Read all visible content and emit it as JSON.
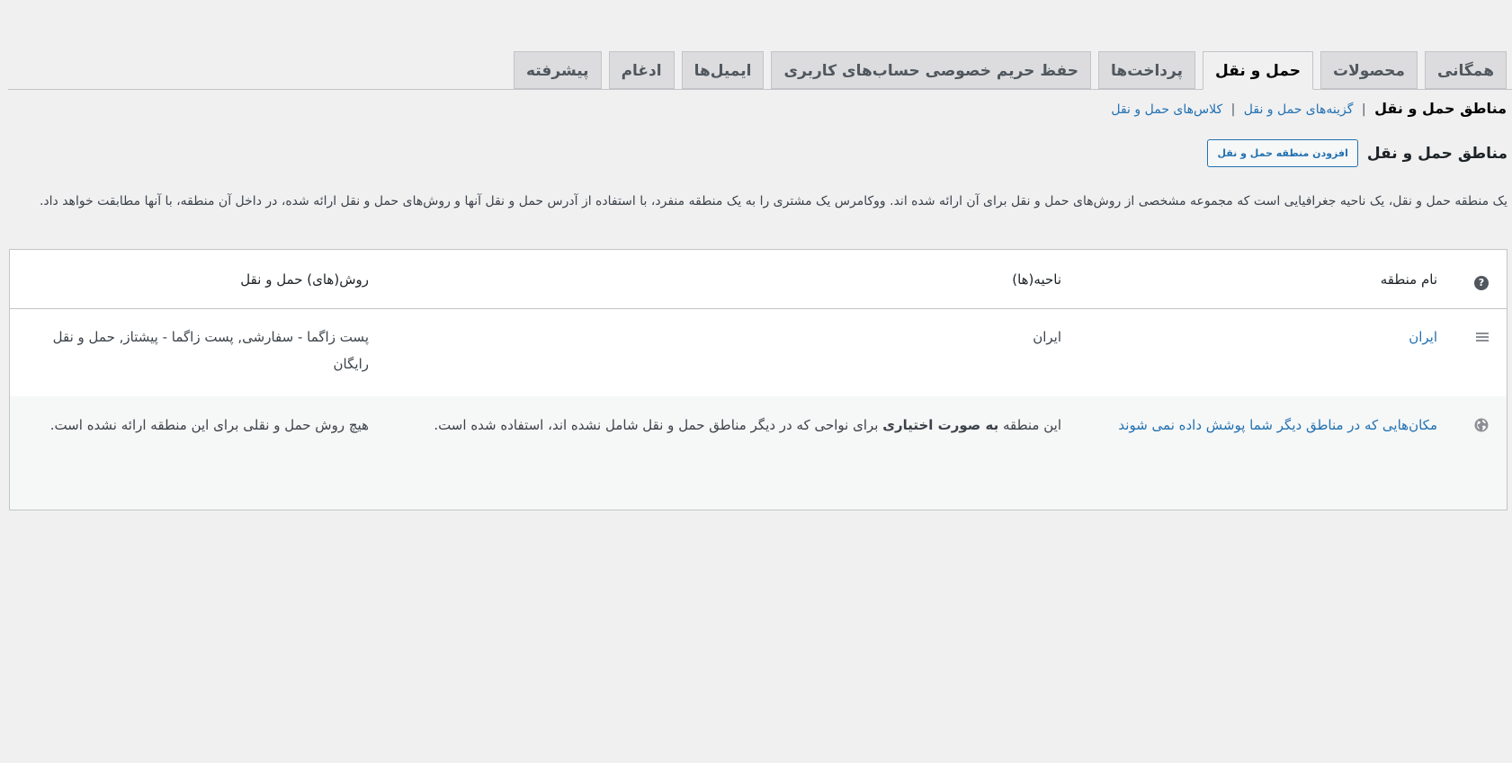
{
  "tabs": [
    {
      "label": "همگانی",
      "active": false
    },
    {
      "label": "محصولات",
      "active": false
    },
    {
      "label": "حمل و نقل",
      "active": true
    },
    {
      "label": "پرداخت‌ها",
      "active": false
    },
    {
      "label": "حفظ حریم خصوصی حساب‌های کاربری",
      "active": false
    },
    {
      "label": "ایمیل‌ها",
      "active": false
    },
    {
      "label": "ادغام",
      "active": false
    },
    {
      "label": "پیشرفته",
      "active": false
    }
  ],
  "subnav": {
    "current": "مناطق حمل و نقل",
    "options": "گزینه‌های حمل و نقل",
    "classes": "کلاس‌های حمل و نقل",
    "separator": "|"
  },
  "heading": "مناطق حمل و نقل",
  "add_button": "افزودن منطقه حمل و نقل",
  "description": "یک منطقه حمل و نقل، یک ناحیه جغرافیایی است که مجموعه مشخصی از روش‌های حمل و نقل برای آن ارائه شده اند. ووکامرس یک مشتری را به یک منطقه منفرد، با استفاده از آدرس حمل و نقل آنها و روش‌های حمل و نقل ارائه شده، در داخل آن منطقه، با آنها مطابقت خواهد داد.",
  "table": {
    "headers": {
      "name": "نام منطقه",
      "region": "ناحیه(ها)",
      "methods": "روش(های) حمل و نقل"
    },
    "rows": [
      {
        "name": "ایران",
        "region": "ایران",
        "methods": "پست زاگما - سفارشی, پست زاگما - پیشتاز, حمل و نقل رایگان"
      }
    ],
    "rest": {
      "name": "مکان‌هایی که در مناطق دیگر شما پوشش داده نمی شوند",
      "region_pre": "این منطقه ",
      "region_bold": "به صورت اختیاری",
      "region_post": " برای نواحی که در دیگر مناطق حمل و نقل شامل نشده اند، استفاده شده است.",
      "methods": "هیچ روش حمل و نقلی برای این منطقه ارائه نشده است."
    }
  },
  "icons": {
    "help": "help-icon",
    "drag": "drag-handle-icon",
    "globe": "globe-icon"
  },
  "help_glyph": "?"
}
